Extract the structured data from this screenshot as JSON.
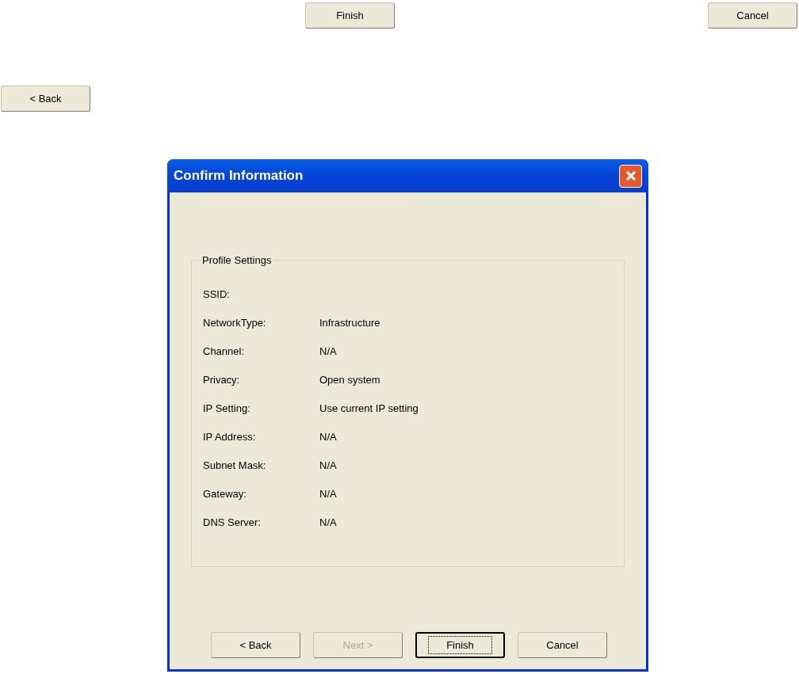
{
  "loose_buttons": [
    {
      "label": "Finish"
    },
    {
      "label": "Cancel"
    },
    {
      "label": "< Back"
    }
  ],
  "dialog": {
    "title": "Confirm Information",
    "group": {
      "label": "Profile Settings",
      "rows": [
        {
          "label": "SSID:",
          "value": ""
        },
        {
          "label": "NetworkType:",
          "value": "Infrastructure"
        },
        {
          "label": "Channel:",
          "value": "N/A"
        },
        {
          "label": "Privacy:",
          "value": "Open system"
        },
        {
          "label": "IP Setting:",
          "value": "Use current IP setting"
        },
        {
          "label": "IP Address:",
          "value": "N/A"
        },
        {
          "label": "Subnet Mask:",
          "value": "N/A"
        },
        {
          "label": "Gateway:",
          "value": "N/A"
        },
        {
          "label": "DNS Server:",
          "value": "N/A"
        }
      ]
    },
    "buttons": [
      {
        "label": "< Back",
        "disabled": false,
        "focused": false
      },
      {
        "label": "Next >",
        "disabled": true,
        "focused": false
      },
      {
        "label": "Finish",
        "disabled": false,
        "focused": true
      },
      {
        "label": "Cancel",
        "disabled": false,
        "focused": false
      }
    ]
  }
}
